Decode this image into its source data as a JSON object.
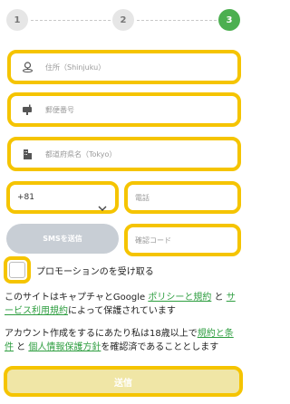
{
  "stepper": {
    "steps": [
      "1",
      "2",
      "3"
    ],
    "active_step": 3
  },
  "fields": {
    "address_placeholder": "住所（Shinjuku）",
    "postal_placeholder": "郵便番号",
    "prefecture_placeholder": "都道府県名（Tokyo）",
    "country_code": "+81",
    "phone_placeholder": "電話",
    "code_placeholder": "確認コード"
  },
  "buttons": {
    "sms": "SMSを送信",
    "submit": "送信"
  },
  "promo_checkbox": {
    "label": "プロモーションのを受け取る",
    "checked": false
  },
  "recaptcha_notice": {
    "pre": "このサイトはキャプチャとGoogle ",
    "privacy_link": "ポリシーと規約",
    "and": " と ",
    "terms_link": "サービス利用規約",
    "post": "によって保護されています"
  },
  "age_notice": {
    "pre": "アカウント作成をするにあたり私は18歳以上で",
    "terms_link": "規約と条件",
    "and": " と ",
    "privacy_link": "個人情報保護方針",
    "post": "を確認済であることとします"
  },
  "colors": {
    "accent_yellow": "#f5c400",
    "active_step": "#4caf50",
    "link": "#2e9e40",
    "disabled_button": "#c8ced5"
  }
}
